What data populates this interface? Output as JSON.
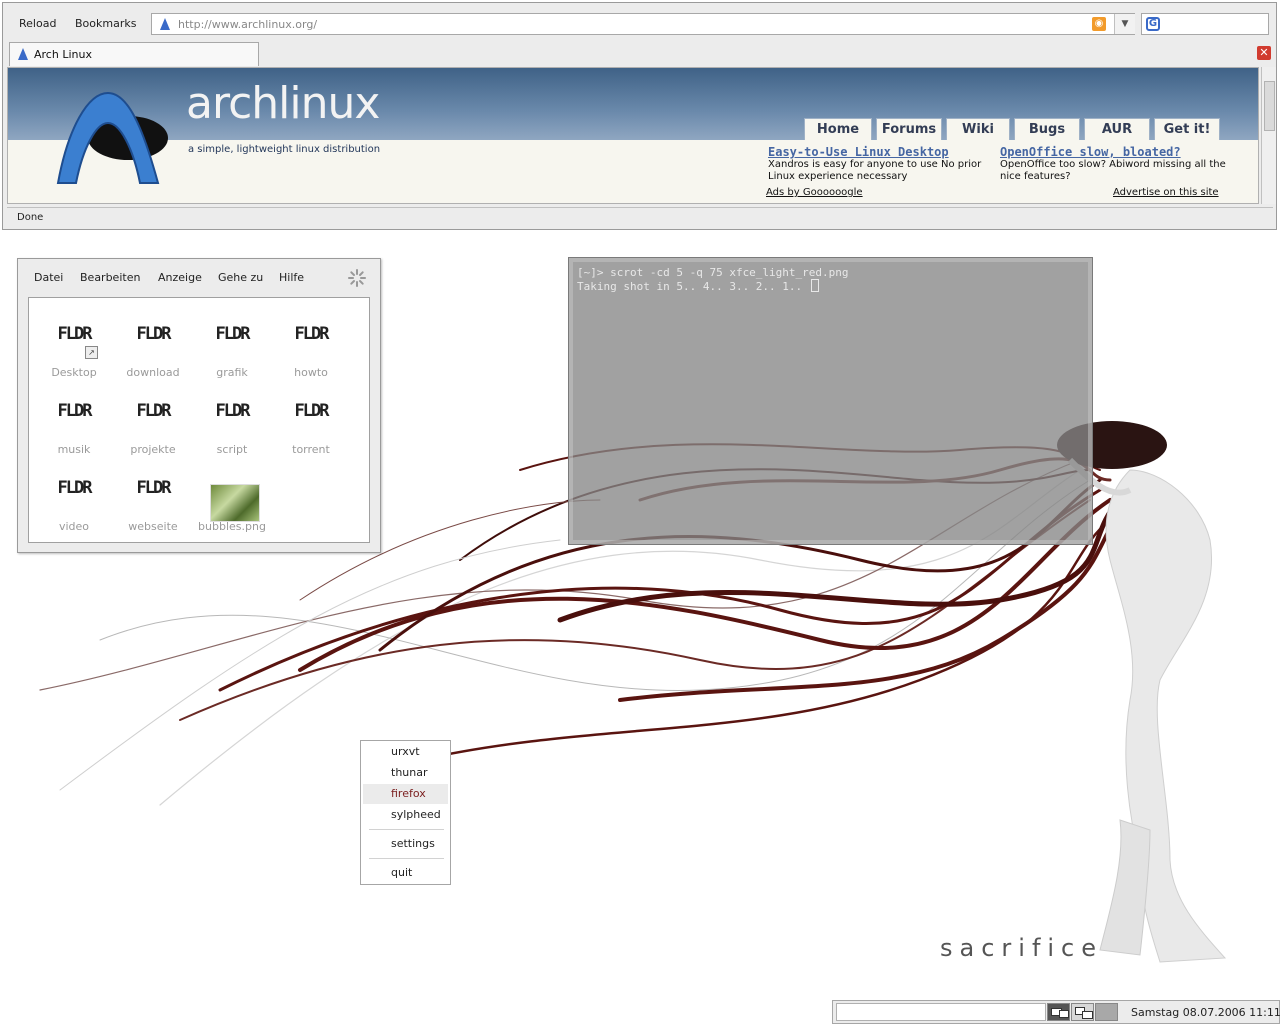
{
  "wallpaper": {
    "title": "sacrifice",
    "strand_color": "#5a1410"
  },
  "browser": {
    "toolbar": {
      "reload_label": "Reload",
      "bookmarks_label": "Bookmarks"
    },
    "url": "http://www.archlinux.org/",
    "tab": {
      "label": "Arch Linux"
    },
    "status": "Done",
    "page": {
      "wordmark_thin": "arch",
      "wordmark_bold": "linux",
      "tagline": "a simple, lightweight linux distribution",
      "nav": [
        "Home",
        "Forums",
        "Wiki",
        "Bugs",
        "AUR",
        "Get it!"
      ],
      "ads": [
        {
          "title": "Easy-to-Use Linux Desktop",
          "body": "Xandros is easy for anyone to use No prior Linux experience necessary"
        },
        {
          "title": "OpenOffice slow, bloated?",
          "body": "OpenOffice too slow? Abiword missing all the nice features?"
        }
      ],
      "ads_by": "Ads by Goooooogle",
      "advertise": "Advertise on this site",
      "header_color": "#4f7098"
    }
  },
  "filemanager": {
    "menu": [
      "Datei",
      "Bearbeiten",
      "Anzeige",
      "Gehe zu",
      "Hilfe"
    ],
    "icon_text": "FLDR",
    "items": [
      {
        "label": "Desktop"
      },
      {
        "label": "download"
      },
      {
        "label": "grafik"
      },
      {
        "label": "howto"
      },
      {
        "label": "musik"
      },
      {
        "label": "projekte"
      },
      {
        "label": "script"
      },
      {
        "label": "torrent"
      },
      {
        "label": "video"
      },
      {
        "label": "webseite"
      },
      {
        "label": "bubbles.png"
      }
    ]
  },
  "terminal": {
    "lines": [
      "[~]> scrot -cd 5 -q 75 xfce_light_red.png",
      "Taking shot in 5.. 4.. 3.. 2.. 1.. "
    ]
  },
  "root_menu": {
    "items": [
      "urxvt",
      "thunar",
      "firefox",
      "sylpheed",
      "settings",
      "quit"
    ],
    "active": "firefox"
  },
  "panel": {
    "clock": "Samstag 08.07.2006 11:11",
    "workspaces": 3
  }
}
